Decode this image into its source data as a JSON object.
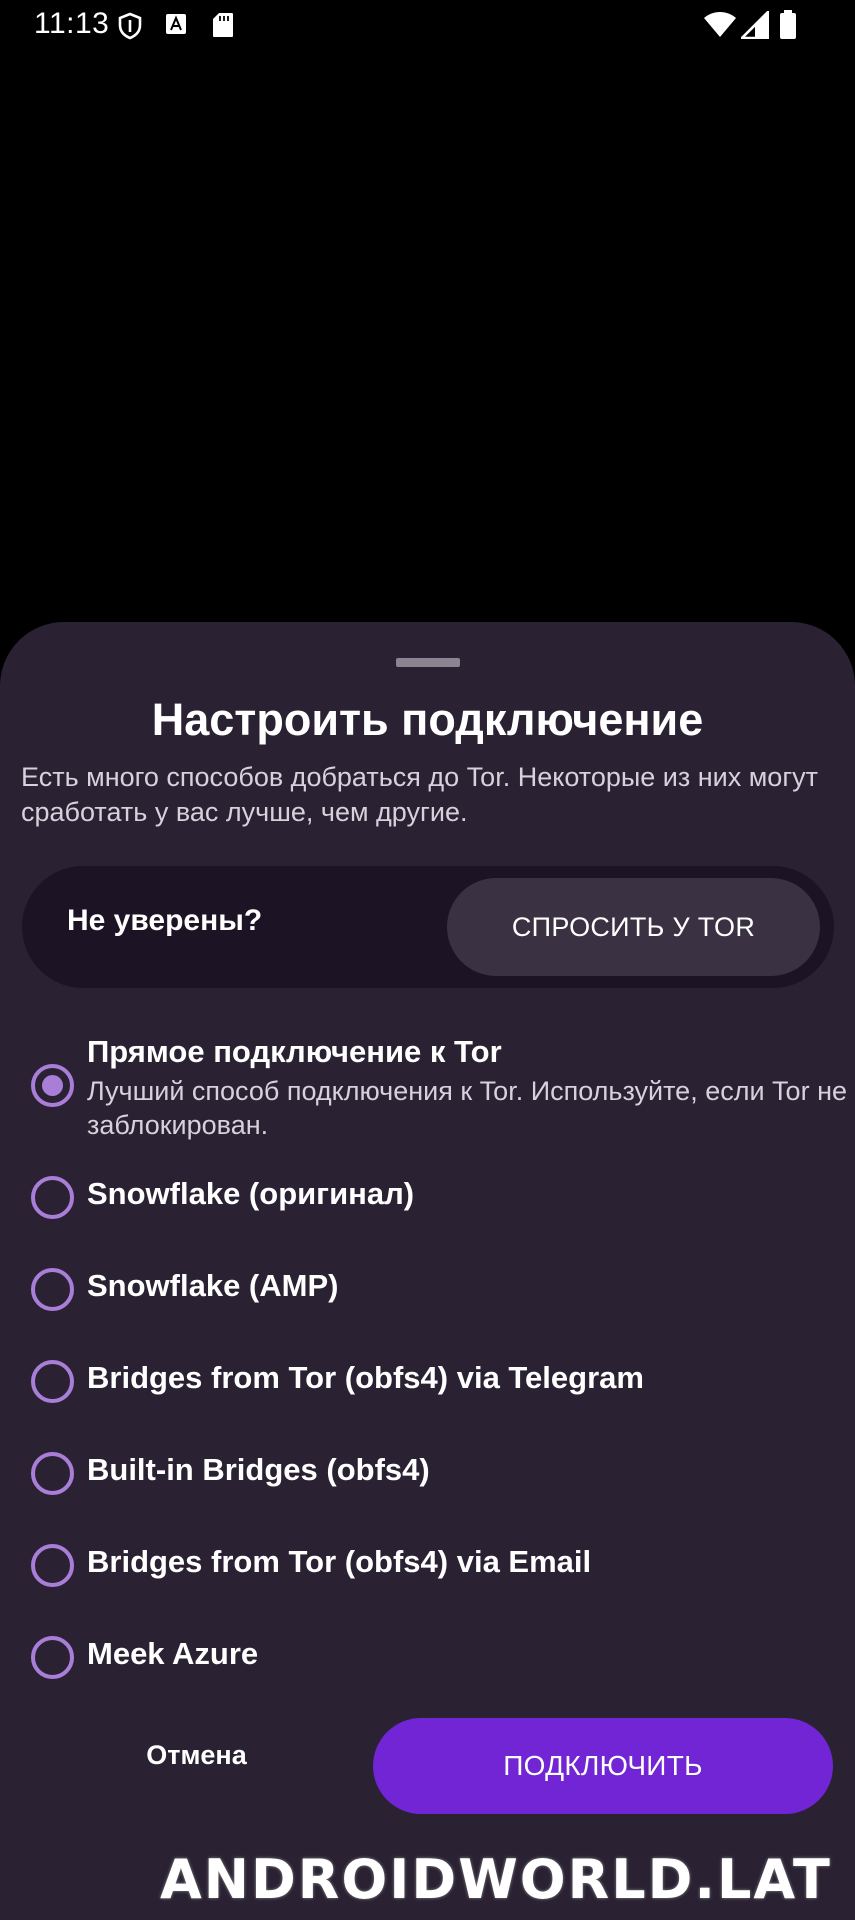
{
  "status_bar": {
    "time": "11:13",
    "icons": [
      "shield-icon",
      "a-keyboard-icon",
      "sd-card-icon",
      "wifi-icon",
      "signal-icon",
      "battery-icon"
    ]
  },
  "sheet": {
    "title": "Настроить подключение",
    "subtitle": "Есть много способов добраться до Tor. Некоторые из них могут сработать у вас лучше, чем другие.",
    "unsure_label": "Не уверены?",
    "ask_tor_label": "СПРОСИТЬ У TOR",
    "options": [
      {
        "label": "Прямое подключение к Tor",
        "description": "Лучший способ подключения к Tor. Используйте, если Tor не заблокирован.",
        "selected": true
      },
      {
        "label": "Snowflake (оригинал)",
        "selected": false
      },
      {
        "label": "Snowflake (AMP)",
        "selected": false
      },
      {
        "label": "Bridges from Tor (obfs4) via Telegram",
        "selected": false
      },
      {
        "label": "Built-in Bridges (obfs4)",
        "selected": false
      },
      {
        "label": "Bridges from Tor (obfs4) via Email",
        "selected": false
      },
      {
        "label": "Meek Azure",
        "selected": false
      }
    ],
    "cancel_label": "Отмена",
    "connect_label": "ПОДКЛЮЧИТЬ"
  },
  "colors": {
    "sheet_bg": "#2a2233",
    "accent": "#7225d4",
    "radio": "#a97ed8"
  },
  "watermark": "ANDROIDWORLD.LAT"
}
